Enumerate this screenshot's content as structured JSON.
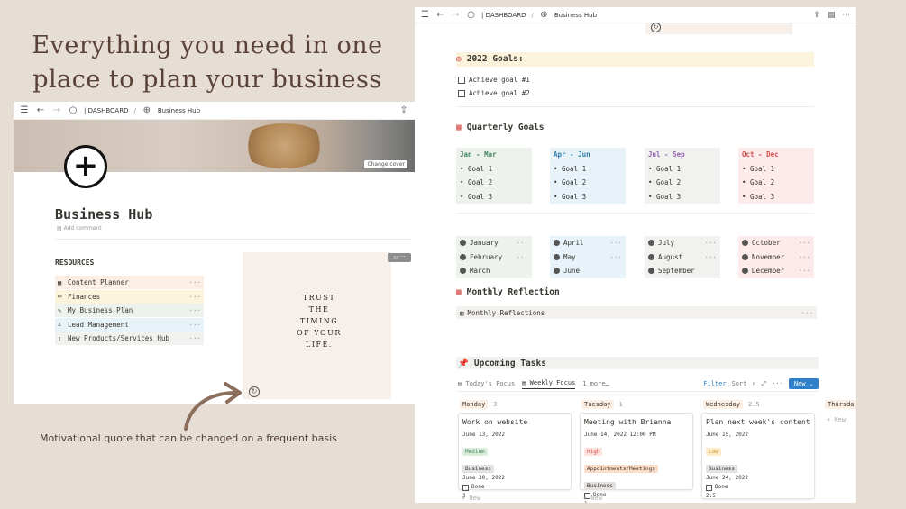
{
  "headline": {
    "line1": "Everything you need in one",
    "line2": "place to plan your business"
  },
  "caption": "Motivational quote that can be changed on a frequent basis",
  "left_window": {
    "breadcrumb_1": "| DASHBOARD",
    "sep": "/",
    "breadcrumb_2": "Business Hub",
    "change_cover": "Change cover",
    "page_title": "Business Hub",
    "add_comment": "Add comment",
    "resources_heading": "RESOURCES",
    "resources": [
      {
        "label": "Content Planner",
        "color": "#fbeee4"
      },
      {
        "label": "Finances",
        "color": "#fbf3db"
      },
      {
        "label": "My Business Plan",
        "color": "#edf3ec"
      },
      {
        "label": "Lead Management",
        "color": "#e7f3f8"
      },
      {
        "label": "New Products/Services Hub",
        "color": "#f1f1ef"
      }
    ],
    "quote_lines": [
      "TRUST",
      "THE",
      "TIMING",
      "OF YOUR",
      "LIFE."
    ]
  },
  "right_window": {
    "breadcrumb_1": "| DASHBOARD",
    "sep": "/",
    "breadcrumb_2": "Business Hub",
    "goals_heading": "2022 Goals:",
    "goals": [
      "Achieve goal #1",
      "Achieve goal #2"
    ],
    "quarterly_heading": "Quarterly Goals",
    "quarters": [
      {
        "title": "Jan - Mar",
        "goals": [
          "Goal 1",
          "Goal 2",
          "Goal 3"
        ],
        "bg": "#edf3ec",
        "color": "#448361"
      },
      {
        "title": "Apr - Jun",
        "goals": [
          "Goal 1",
          "Goal 2",
          "Goal 3"
        ],
        "bg": "#e7f3f8",
        "color": "#337ea9"
      },
      {
        "title": "Jul - Sep",
        "goals": [
          "Goal 1",
          "Goal 2",
          "Goal 3"
        ],
        "bg": "#f1f1ef",
        "color": "#9065b0"
      },
      {
        "title": "Oct - Dec",
        "goals": [
          "Goal 1",
          "Goal 2",
          "Goal 3"
        ],
        "bg": "#fdebec",
        "color": "#d44c47"
      }
    ],
    "months": [
      [
        "January",
        "February",
        "March"
      ],
      [
        "April",
        "May",
        "June"
      ],
      [
        "July",
        "August",
        "September"
      ],
      [
        "October",
        "November",
        "December"
      ]
    ],
    "monthly_heading": "Monthly Reflection",
    "monthly_item": "Monthly Reflections",
    "tasks_heading": "Upcoming Tasks",
    "tabs": {
      "tab1": "Today's Focus",
      "tab2": "Weekly Focus",
      "more": "1 more…",
      "filter": "Filter",
      "sort": "Sort",
      "new": "New"
    },
    "days": [
      {
        "name": "Monday",
        "count": "3",
        "bg": "#fbeee4"
      },
      {
        "name": "Tuesday",
        "count": "1",
        "bg": "#fbeee4"
      },
      {
        "name": "Wednesday",
        "count": "2.5",
        "bg": "#fbeee4"
      },
      {
        "name": "Thursda",
        "count": "",
        "bg": "#fbeee4"
      }
    ],
    "cards": [
      {
        "title": "Work on website",
        "date1": "June 13, 2022",
        "priority": "Medium",
        "priority_bg": "#dbeddb",
        "category": "Business",
        "date2": "June 30, 2022",
        "done": "Done",
        "num": "3"
      },
      {
        "title": "Meeting with Brianna",
        "date1": "June 14, 2022 12:00 PM",
        "priority": "High",
        "priority_bg": "#ffe2dd",
        "category": "Appointments/Meetings",
        "category2": "Business",
        "done": "Done",
        "num": "1"
      },
      {
        "title": "Plan next week's content",
        "date1": "June 15, 2022",
        "priority": "Low",
        "priority_bg": "#fdecc8",
        "category": "Business",
        "date2": "June 24, 2022",
        "done": "Done",
        "num": "2.5"
      }
    ],
    "add_new": "+ New"
  }
}
